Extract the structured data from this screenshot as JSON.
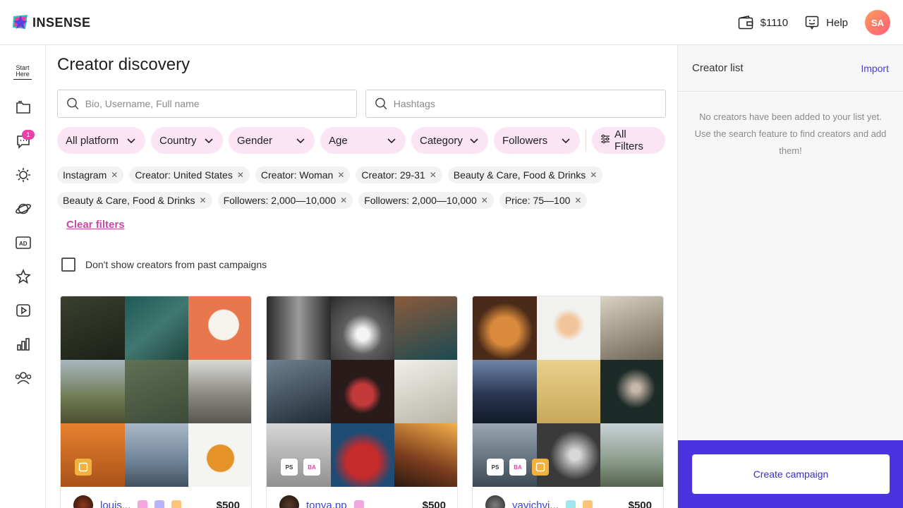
{
  "brand": {
    "name": "INSENSE"
  },
  "header": {
    "balance": "$1110",
    "help_label": "Help",
    "avatar_initials": "SA"
  },
  "sidebar": {
    "start_here_line1": "Start",
    "start_here_line2": "Here",
    "messages_badge": "1",
    "icons": [
      "folder-icon",
      "message-icon",
      "sparkle-icon",
      "planet-icon",
      "ad-icon",
      "star-icon",
      "video-icon",
      "chart-icon",
      "people-icon"
    ]
  },
  "main": {
    "title": "Creator discovery",
    "search_placeholder": "Bio, Username, Full name",
    "hashtags_placeholder": "Hashtags",
    "filters": [
      "All platform",
      "Country",
      "Gender",
      "Age",
      "Category",
      "Followers"
    ],
    "all_filters_label": "All Filters",
    "chips_row1": [
      "Instagram",
      "Creator: United States",
      "Creator: Woman",
      "Creator: 29-31",
      "Beauty & Care, Food & Drinks"
    ],
    "chips_row2": [
      "Beauty & Care, Food & Drinks",
      "Followers: 2,000—10,000",
      "Followers: 2,000—10,000",
      "Price: 75—100"
    ],
    "clear_filters": "Clear filters",
    "past_campaigns_label": "Don't show creators from past campaigns"
  },
  "cards": [
    {
      "username": "louis...",
      "price": "$500",
      "overlay": []
    },
    {
      "username": "tonya.pp",
      "price": "$500",
      "overlay": [
        "PS",
        "BA"
      ]
    },
    {
      "username": "yavichvi...",
      "price": "$500",
      "overlay": [
        "PS",
        "BA"
      ]
    }
  ],
  "right_panel": {
    "title": "Creator list",
    "import_label": "Import",
    "empty_text": "No creators have been added to your list yet. Use the search feature to find creators and add them!",
    "cta_label": "Create campaign"
  },
  "colors": {
    "accent": "#4b33e0",
    "pink": "#fbe5f4",
    "clear_link": "#c54aa8",
    "badge": "#e940a9"
  }
}
